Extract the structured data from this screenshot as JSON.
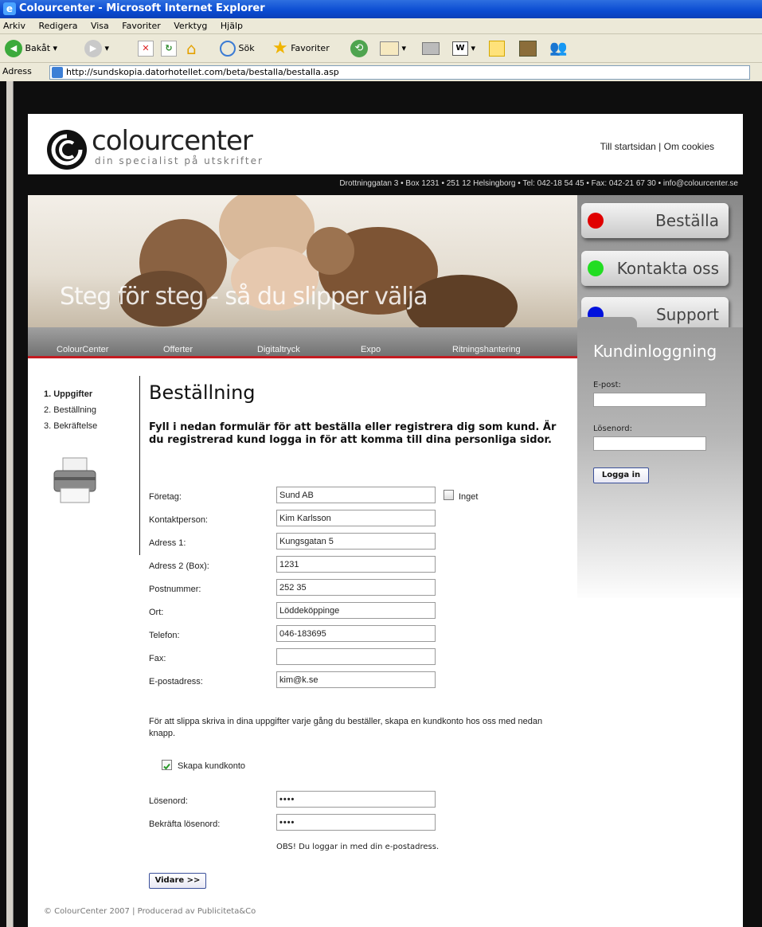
{
  "browser": {
    "title": "Colourcenter - Microsoft Internet Explorer",
    "menu": [
      "Arkiv",
      "Redigera",
      "Visa",
      "Favoriter",
      "Verktyg",
      "Hjälp"
    ],
    "back_label": "Bakåt",
    "search_label": "Sök",
    "favorites_label": "Favoriter",
    "address_label": "Adress",
    "url": "http://sundskopia.datorhotellet.com/beta/bestalla/bestalla.asp"
  },
  "site": {
    "logo_name": "colourcenter",
    "logo_tagline": "din specialist på utskrifter",
    "top_links": {
      "start": "Till startsidan",
      "sep": "|",
      "cookies": "Om cookies"
    },
    "address_line": "Drottninggatan 3 • Box 1231 • 251 12 Helsingborg • Tel: 042-18 54 45 • Fax: 042-21 67 30 • info@colourcenter.se",
    "hero_text": "Steg för steg - så du slipper välja",
    "side_buttons": [
      {
        "label": "Beställa",
        "color": "#e00000"
      },
      {
        "label": "Kontakta oss",
        "color": "#22dd22"
      },
      {
        "label": "Support",
        "color": "#0011dd"
      }
    ],
    "nav": [
      "ColourCenter",
      "Offerter",
      "Digitaltryck",
      "Expo",
      "Ritningshantering"
    ],
    "login": {
      "title": "Kundinloggning",
      "email_label": "E-post:",
      "password_label": "Lösenord:",
      "button": "Logga in"
    },
    "steps": [
      "1. Uppgifter",
      "2. Beställning",
      "3. Bekräftelse"
    ],
    "page_title": "Beställning",
    "intro": "Fyll i nedan formulär för att beställa eller registrera dig som kund. Är du registrerad kund logga in för att komma till dina personliga sidor.",
    "form": {
      "company_label": "Företag:",
      "company_value": "Sund AB",
      "none_label": "Inget",
      "contact_label": "Kontaktperson:",
      "contact_value": "Kim Karlsson",
      "address1_label": "Adress 1:",
      "address1_value": "Kungsgatan 5",
      "address2_label": "Adress 2 (Box):",
      "address2_value": "1231",
      "zip_label": "Postnummer:",
      "zip_value": "252 35",
      "city_label": "Ort:",
      "city_value": "Löddeköppinge",
      "phone_label": "Telefon:",
      "phone_value": "046-183695",
      "fax_label": "Fax:",
      "fax_value": "",
      "email_label": "E-postadress:",
      "email_value": "kim@k.se",
      "note": "För att slippa skriva in dina uppgifter varje gång du beställer, skapa en kundkonto hos oss med nedan knapp.",
      "create_account_label": "Skapa kundkonto",
      "create_account_checked": true,
      "password_label": "Lösenord:",
      "password_value": "••••",
      "confirm_label": "Bekräfta lösenord:",
      "confirm_value": "••••",
      "obs": "OBS! Du loggar in med din e-postadress.",
      "submit": "Vidare >>"
    },
    "footer": "© ColourCenter 2007 | Producerad av Publiciteta&Co"
  }
}
